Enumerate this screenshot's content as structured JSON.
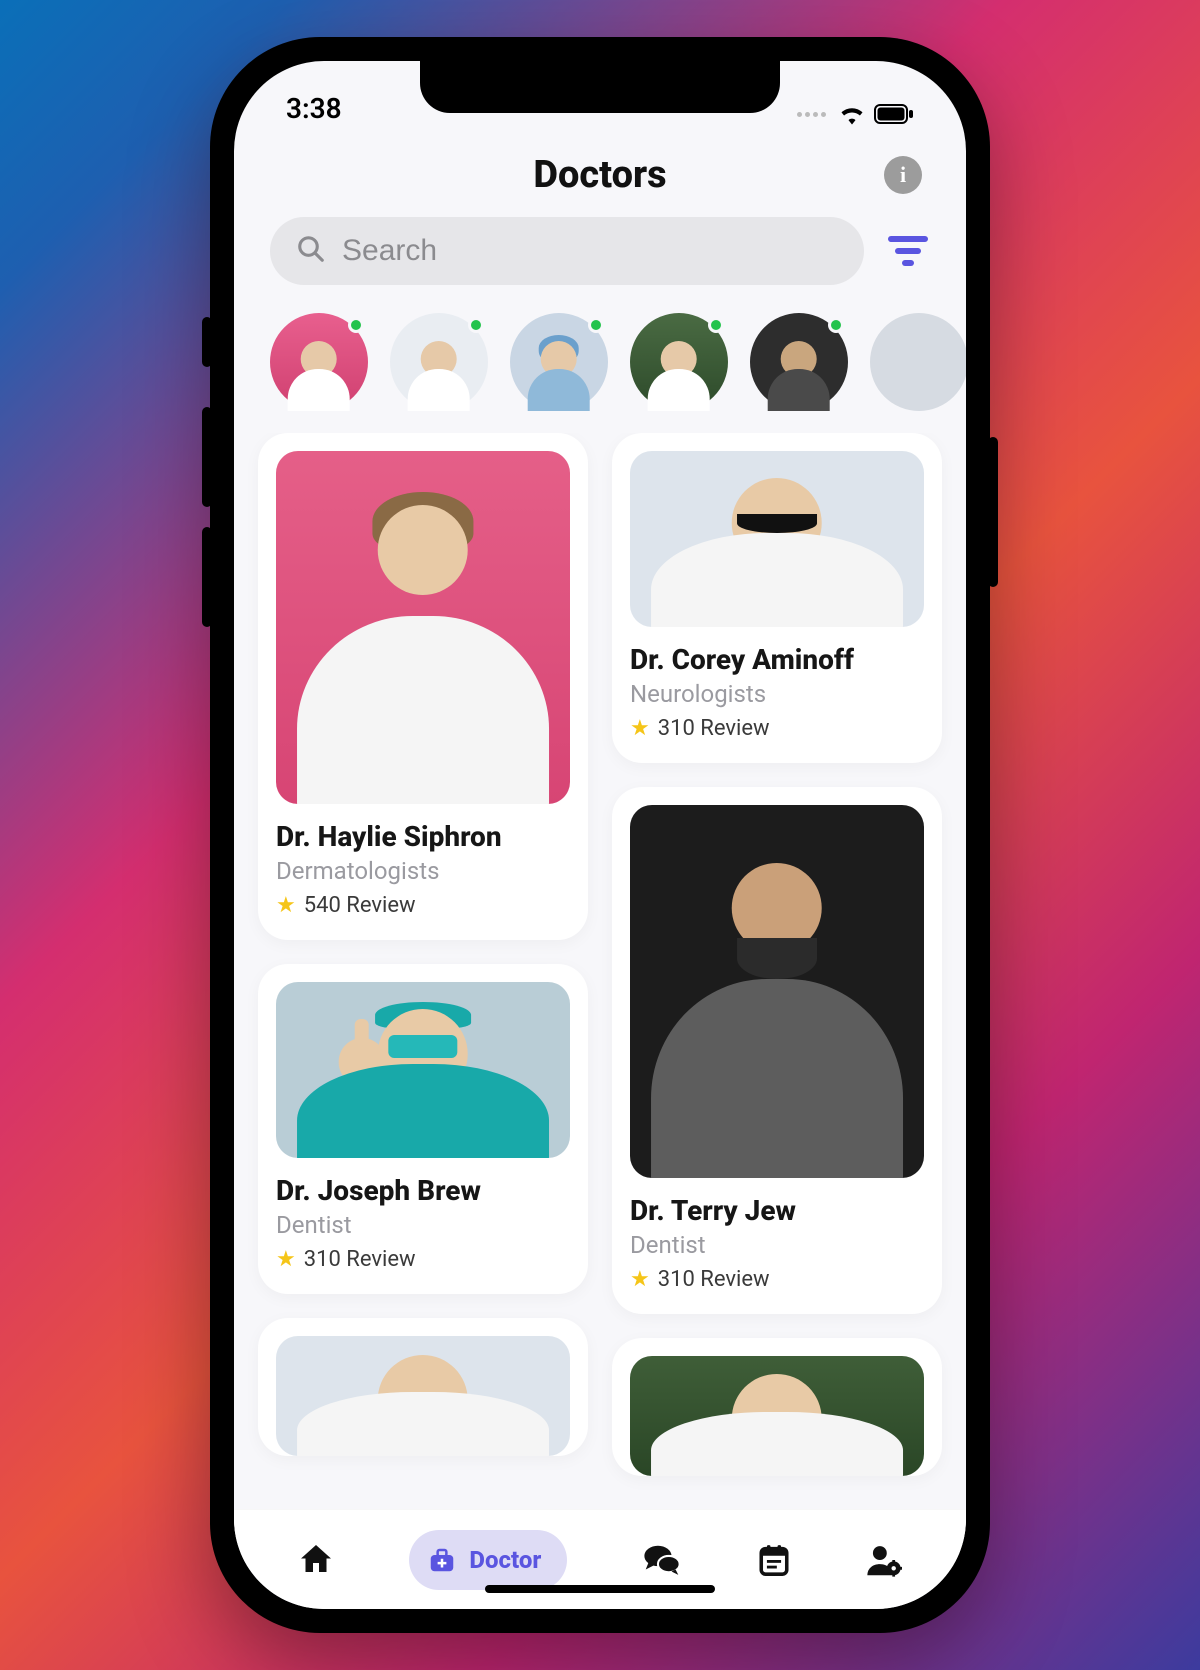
{
  "status": {
    "time": "3:38"
  },
  "header": {
    "title": "Doctors",
    "info_label": "i"
  },
  "search": {
    "placeholder": "Search"
  },
  "stories": [
    {
      "name": "story-1",
      "online": true
    },
    {
      "name": "story-2",
      "online": true
    },
    {
      "name": "story-3",
      "online": true
    },
    {
      "name": "story-4",
      "online": true
    },
    {
      "name": "story-5",
      "online": true
    },
    {
      "name": "story-6",
      "online": true
    }
  ],
  "doctors": {
    "left": [
      {
        "name": "Dr. Haylie Siphron",
        "specialty": "Dermatologists",
        "reviews": "540 Review",
        "thumb": "pink-coat",
        "size": "tall"
      },
      {
        "name": "Dr. Joseph Brew",
        "specialty": "Dentist",
        "reviews": "310 Review",
        "thumb": "teal-scrubs",
        "size": "short"
      }
    ],
    "right": [
      {
        "name": "Dr. Corey Aminoff",
        "specialty": "Neurologists",
        "reviews": "310 Review",
        "thumb": "grey-coat",
        "size": "short"
      },
      {
        "name": "Dr. Terry Jew",
        "specialty": "Dentist",
        "reviews": "310 Review",
        "thumb": "dark-grey",
        "size": "med"
      }
    ],
    "peek_left": {
      "thumb": "grey-coat"
    },
    "peek_right": {
      "thumb": "green"
    }
  },
  "nav": {
    "home": "Home",
    "doctor": "Doctor",
    "chat": "Chat",
    "calendar": "Calendar",
    "profile": "Profile"
  },
  "accent": "#5a55e0"
}
